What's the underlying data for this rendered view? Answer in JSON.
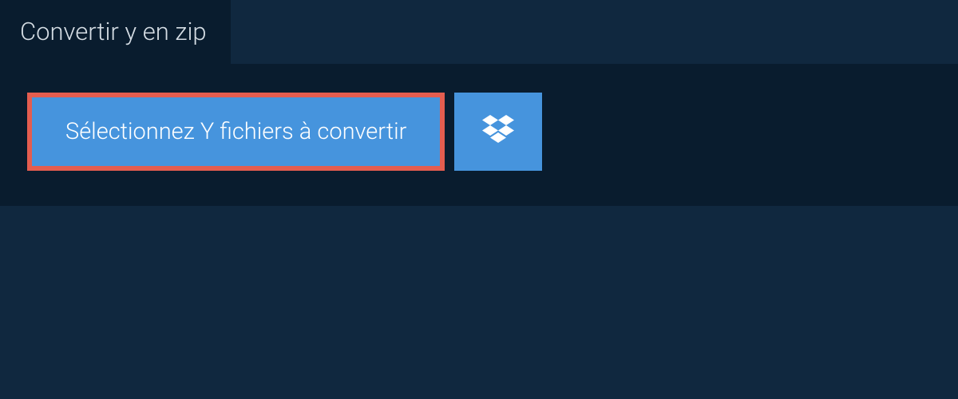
{
  "tab": {
    "label": "Convertir y en zip"
  },
  "main": {
    "select_button_label": "Sélectionnez Y fichiers à convertir"
  }
}
